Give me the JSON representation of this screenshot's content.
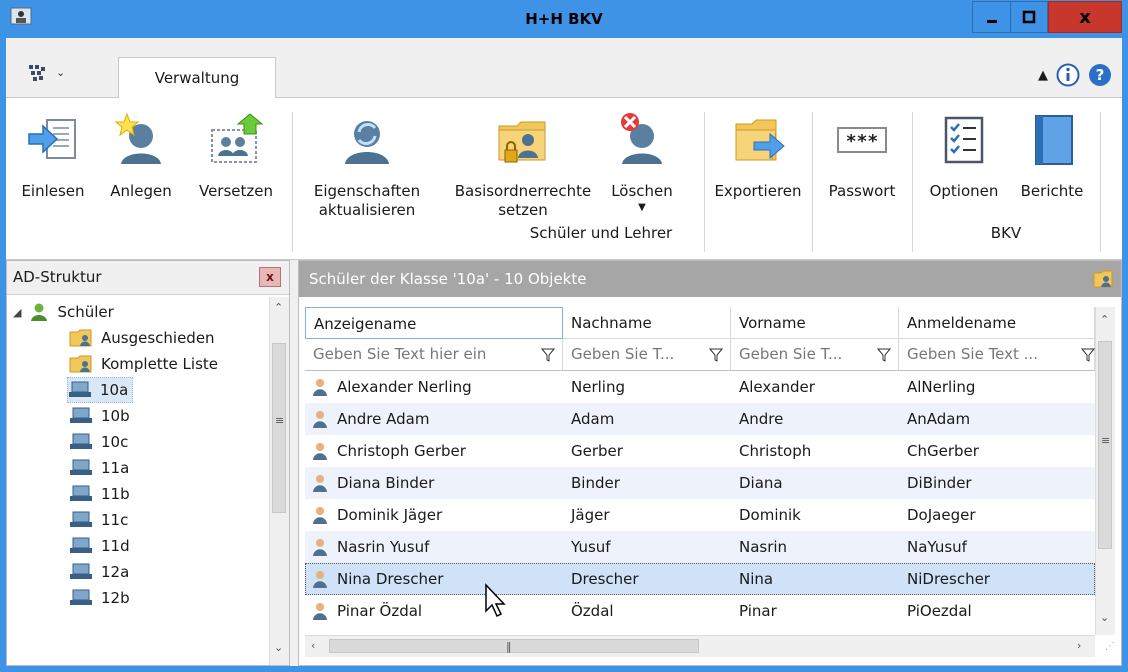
{
  "window": {
    "title": "H+H BKV",
    "close_label": "x",
    "icons": {
      "app": "app-icon",
      "minimize": "minimize-icon",
      "maximize": "maximize-icon",
      "close": "close-icon"
    }
  },
  "ribbon": {
    "tab": "Verwaltung",
    "quick_menu_icon": "grid-menu-icon",
    "buttons": [
      {
        "label": "Einlesen",
        "icon": "import-icon"
      },
      {
        "label": "Anlegen",
        "icon": "add-user-icon"
      },
      {
        "label": "Versetzen",
        "icon": "move-users-icon"
      },
      {
        "label": "Eigenschaften aktualisieren",
        "line1": "Eigenschaften",
        "line2": "aktualisieren",
        "icon": "refresh-user-icon"
      },
      {
        "label": "Basisordnerrechte setzen",
        "line1": "Basisordnerrechte",
        "line2": "setzen",
        "icon": "folder-lock-icon"
      },
      {
        "label": "Löschen",
        "icon": "delete-user-icon",
        "has_dropdown": true
      },
      {
        "label": "Exportieren",
        "icon": "export-folder-icon"
      },
      {
        "label": "Passwort",
        "icon": "password-icon",
        "icon_text": "***"
      },
      {
        "label": "Optionen",
        "icon": "checklist-icon"
      },
      {
        "label": "Berichte",
        "icon": "book-icon"
      }
    ],
    "groups": [
      {
        "label": "Schüler und Lehrer"
      },
      {
        "label": "BKV"
      }
    ]
  },
  "left_panel": {
    "title": "AD-Struktur",
    "close_label": "x",
    "tree": {
      "root": {
        "label": "Schüler",
        "icon": "user-group-icon",
        "expanded": true
      },
      "children": [
        {
          "label": "Ausgeschieden",
          "icon": "folder-user-icon"
        },
        {
          "label": "Komplette Liste",
          "icon": "folder-user-icon"
        },
        {
          "label": "10a",
          "icon": "class-icon",
          "selected": true
        },
        {
          "label": "10b",
          "icon": "class-icon"
        },
        {
          "label": "10c",
          "icon": "class-icon"
        },
        {
          "label": "11a",
          "icon": "class-icon"
        },
        {
          "label": "11b",
          "icon": "class-icon"
        },
        {
          "label": "11c",
          "icon": "class-icon"
        },
        {
          "label": "11d",
          "icon": "class-icon"
        },
        {
          "label": "12a",
          "icon": "class-icon"
        },
        {
          "label": "12b",
          "icon": "class-icon"
        }
      ]
    }
  },
  "right_panel": {
    "title": "Schüler der Klasse '10a' - 10 Objekte",
    "header_icon": "folder-user-icon",
    "grid": {
      "columns": [
        {
          "header": "Anzeigename",
          "filter_placeholder": "Geben Sie Text hier ein"
        },
        {
          "header": "Nachname",
          "filter_placeholder": "Geben Sie T..."
        },
        {
          "header": "Vorname",
          "filter_placeholder": "Geben Sie T..."
        },
        {
          "header": "Anmeldename",
          "filter_placeholder": "Geben Sie Text ..."
        }
      ],
      "filter_icon": "filter-icon",
      "row_icon": "user-icon",
      "rows": [
        {
          "anzeigename": "Alexander Nerling",
          "nachname": "Nerling",
          "vorname": "Alexander",
          "anmeldename": "AlNerling"
        },
        {
          "anzeigename": "Andre Adam",
          "nachname": "Adam",
          "vorname": "Andre",
          "anmeldename": "AnAdam"
        },
        {
          "anzeigename": "Christoph Gerber",
          "nachname": "Gerber",
          "vorname": "Christoph",
          "anmeldename": "ChGerber"
        },
        {
          "anzeigename": "Diana Binder",
          "nachname": "Binder",
          "vorname": "Diana",
          "anmeldename": "DiBinder"
        },
        {
          "anzeigename": "Dominik Jäger",
          "nachname": "Jäger",
          "vorname": "Dominik",
          "anmeldename": "DoJaeger"
        },
        {
          "anzeigename": "Nasrin Yusuf",
          "nachname": "Yusuf",
          "vorname": "Nasrin",
          "anmeldename": "NaYusuf"
        },
        {
          "anzeigename": "Nina Drescher",
          "nachname": "Drescher",
          "vorname": "Nina",
          "anmeldename": "NiDrescher",
          "selected": true
        },
        {
          "anzeigename": "Pinar Özdal",
          "nachname": "Özdal",
          "vorname": "Pinar",
          "anmeldename": "PiOezdal"
        }
      ]
    }
  },
  "colors": {
    "title_bar": "#3e93e6",
    "close_button": "#c7372b",
    "panel_header": "#a6a6a6",
    "row_alt": "#eef3fb",
    "row_selected": "#cfe2f7"
  }
}
